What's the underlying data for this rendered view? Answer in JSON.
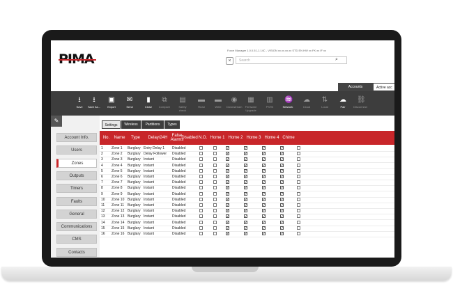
{
  "app": {
    "logo": "PIMA",
    "title_line": "Force Manager 1.0.0.51-1.14C - VISION   xx.xx.xx.xx STD   EN  HW xx FK xx IF xx",
    "search_placeholder": "Search",
    "tabs": [
      "Accounts",
      "Active acc"
    ]
  },
  "toolbar": [
    {
      "label": "Save",
      "icon": "download-icon",
      "dim": false
    },
    {
      "label": "Save As...",
      "icon": "save-as-icon",
      "dim": false
    },
    {
      "label": "Export",
      "icon": "export-icon",
      "dim": false
    },
    {
      "label": "Send",
      "icon": "send-icon",
      "dim": false
    },
    {
      "label": "Close",
      "icon": "close-doc-icon",
      "dim": false
    },
    {
      "label": "Compare",
      "icon": "compare-icon",
      "dim": true
    },
    {
      "label": "Safety check",
      "icon": "clipboard-icon",
      "dim": true
    },
    {
      "label": "Read",
      "icon": "read-icon",
      "dim": true
    },
    {
      "label": "Write",
      "icon": "write-icon",
      "dim": true
    },
    {
      "label": "Downstream",
      "icon": "downstream-icon",
      "dim": true
    },
    {
      "label": "Firmware Upgrade",
      "icon": "firmware-icon",
      "dim": true
    },
    {
      "label": "PSTN",
      "icon": "pstn-icon",
      "dim": true
    },
    {
      "label": "Network",
      "icon": "network-icon",
      "dim": false
    },
    {
      "label": "Cloud",
      "icon": "cloud-icon",
      "dim": true
    },
    {
      "label": "Local",
      "icon": "local-icon",
      "dim": true
    },
    {
      "label": "Pair",
      "icon": "pair-cloud-icon",
      "dim": false
    },
    {
      "label": "Disconnect",
      "icon": "link-icon",
      "dim": true
    }
  ],
  "sidebar": [
    "Account Info.",
    "Users",
    "Zones",
    "Outputs",
    "Timers",
    "Faults",
    "General",
    "Communications",
    "CMS",
    "Contacts"
  ],
  "sidebar_active": 2,
  "subtabs": [
    "Settings",
    "Wireless",
    "Partitions",
    "Types"
  ],
  "subtab_active": 0,
  "table": {
    "headers": [
      "No.",
      "Name",
      "Type",
      "Delay/24H",
      "False Alarms",
      "Disabled",
      "N.O.",
      "Home 1",
      "Home 2",
      "Home 3",
      "Home 4",
      "Chime"
    ],
    "rows": [
      [
        "1",
        "Zone 1",
        "Burglary",
        "Entry Delay 1",
        "Disabled"
      ],
      [
        "2",
        "Zone 2",
        "Burglary",
        "Delay Follower",
        "Disabled"
      ],
      [
        "3",
        "Zone 3",
        "Burglary",
        "Instant",
        "Disabled"
      ],
      [
        "4",
        "Zone 4",
        "Burglary",
        "Instant",
        "Disabled"
      ],
      [
        "5",
        "Zone 5",
        "Burglary",
        "Instant",
        "Disabled"
      ],
      [
        "6",
        "Zone 6",
        "Burglary",
        "Instant",
        "Disabled"
      ],
      [
        "7",
        "Zone 7",
        "Burglary",
        "Instant",
        "Disabled"
      ],
      [
        "8",
        "Zone 8",
        "Burglary",
        "Instant",
        "Disabled"
      ],
      [
        "9",
        "Zone 9",
        "Burglary",
        "Instant",
        "Disabled"
      ],
      [
        "10",
        "Zone 10",
        "Burglary",
        "Instant",
        "Disabled"
      ],
      [
        "11",
        "Zone 11",
        "Burglary",
        "Instant",
        "Disabled"
      ],
      [
        "12",
        "Zone 12",
        "Burglary",
        "Instant",
        "Disabled"
      ],
      [
        "13",
        "Zone 13",
        "Burglary",
        "Instant",
        "Disabled"
      ],
      [
        "14",
        "Zone 14",
        "Burglary",
        "Instant",
        "Disabled"
      ],
      [
        "15",
        "Zone 15",
        "Burglary",
        "Instant",
        "Disabled"
      ],
      [
        "16",
        "Zone 16",
        "Burglary",
        "Instant",
        "Disabled"
      ]
    ],
    "checks": [
      false,
      false,
      true,
      true,
      true,
      true,
      false
    ]
  },
  "colors": {
    "accent": "#c8262a",
    "toolbar": "#3d3d3d"
  }
}
